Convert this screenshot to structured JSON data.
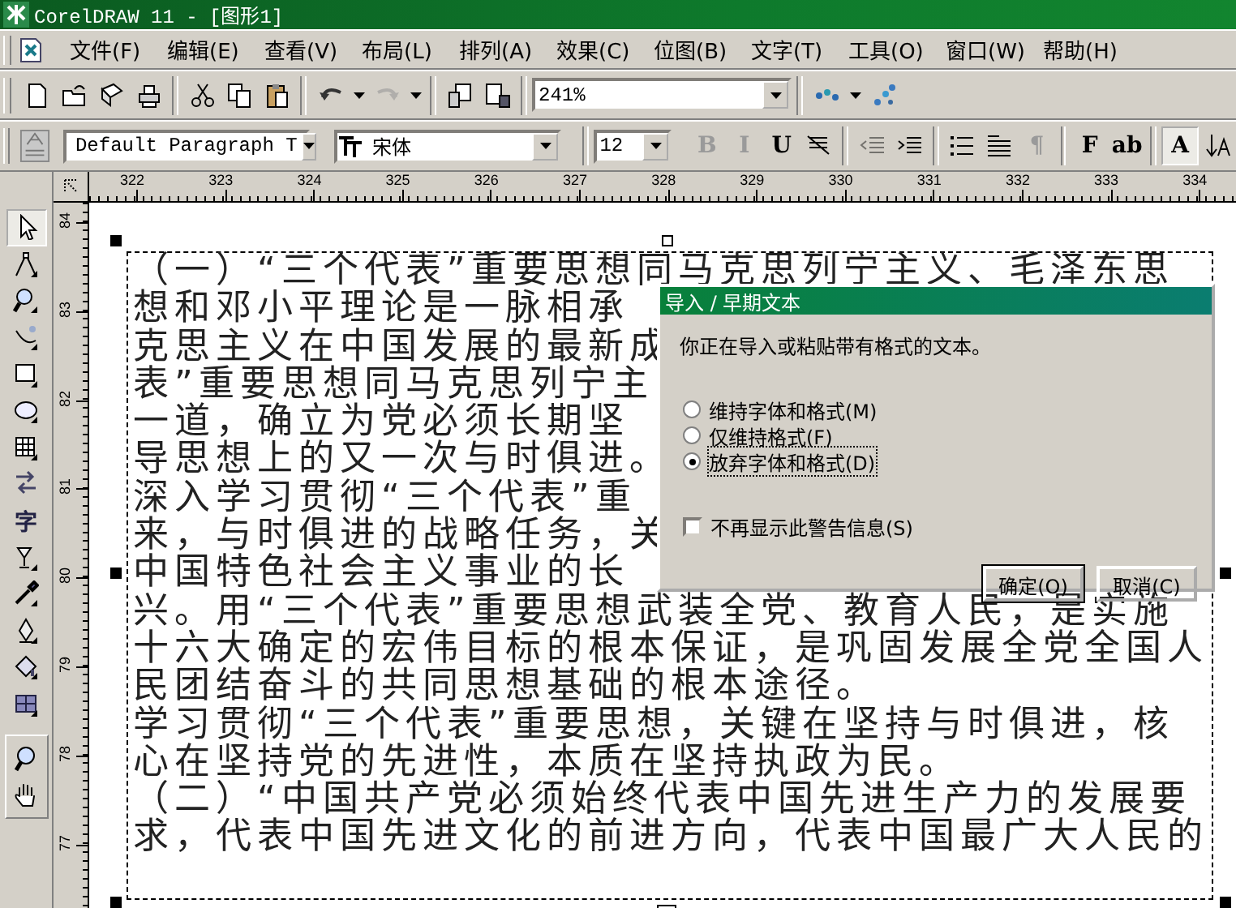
{
  "window": {
    "title": "CorelDRAW 11 - [图形1]"
  },
  "menu": [
    "文件(F)",
    "编辑(E)",
    "查看(V)",
    "布局(L)",
    "排列(A)",
    "效果(C)",
    "位图(B)",
    "文字(T)",
    "工具(O)",
    "窗口(W)",
    "帮助(H)"
  ],
  "standard_toolbar": {
    "redo_disabled": true,
    "zoom": "241%"
  },
  "text_toolbar": {
    "style": "Default Paragraph T",
    "font": "宋体",
    "size": "12",
    "buttons": [
      {
        "kind": "glyph",
        "glyph": "B",
        "disabled": true,
        "pressed": false
      },
      {
        "kind": "glyph",
        "glyph": "I",
        "disabled": true,
        "pressed": false
      },
      {
        "kind": "glyph",
        "glyph": "U",
        "disabled": false,
        "pressed": false
      },
      {
        "kind": "icon",
        "disabled": false,
        "pressed": false
      },
      {
        "kind": "separator"
      },
      {
        "kind": "icon",
        "disabled": true,
        "pressed": false
      },
      {
        "kind": "icon",
        "disabled": false,
        "pressed": false
      },
      {
        "kind": "separator"
      },
      {
        "kind": "icon",
        "disabled": false,
        "pressed": false
      },
      {
        "kind": "icon",
        "disabled": false,
        "pressed": false
      },
      {
        "kind": "glyph",
        "glyph": "¶",
        "disabled": true,
        "pressed": false
      },
      {
        "kind": "separator"
      },
      {
        "kind": "glyph",
        "glyph": "F",
        "disabled": false,
        "pressed": false
      },
      {
        "kind": "glyph",
        "glyph": "ab",
        "disabled": false,
        "pressed": false
      },
      {
        "kind": "separator"
      },
      {
        "kind": "glyph",
        "glyph": "A",
        "disabled": false,
        "pressed": true
      },
      {
        "kind": "icon",
        "disabled": false,
        "pressed": false
      }
    ]
  },
  "toolbox": [
    {
      "kind": "icon",
      "selected": true
    },
    {
      "kind": "icon",
      "selected": false
    },
    {
      "kind": "icon",
      "selected": false
    },
    {
      "kind": "icon",
      "selected": false
    },
    {
      "kind": "icon",
      "selected": false
    },
    {
      "kind": "icon",
      "selected": false
    },
    {
      "kind": "icon",
      "selected": false
    },
    {
      "kind": "icon",
      "selected": false
    },
    {
      "kind": "glyph",
      "glyph": "字",
      "selected": false
    },
    {
      "kind": "icon",
      "selected": false
    },
    {
      "kind": "icon",
      "selected": false
    },
    {
      "kind": "icon",
      "selected": false
    },
    {
      "kind": "icon",
      "selected": false
    },
    {
      "kind": "icon",
      "selected": false
    }
  ],
  "view_tools": [
    {
      "selected": false
    },
    {
      "selected": false
    }
  ],
  "horizontal_ruler": [
    "322",
    "323",
    "324",
    "325",
    "326",
    "327",
    "328",
    "329",
    "330",
    "331",
    "332",
    "333",
    "334"
  ],
  "vertical_ruler": [
    "84",
    "83",
    "82",
    "81",
    "80",
    "79",
    "78",
    "77"
  ],
  "document_lines": [
    "（一）“三个代表”重要思想同马克思列宁主义、毛泽东思",
    "想和邓小平理论是一脉相承",
    "克思主义在中国发展的最新成",
    "表”重要思想同马克思列宁主",
    "一道，确立为党必须长期坚",
    "导思想上的又一次与时俱进。",
    "深入学习贯彻“三个代表”重",
    "来，与时俱进的战略任务，关",
    "中国特色社会主义事业的长",
    "兴。用“三个代表”重要思想武装全党、教育人民，是实施",
    "十六大确定的宏伟目标的根本保证，是巩固发展全党全国人",
    "民团结奋斗的共同思想基础的根本途径。",
    "学习贯彻“三个代表”重要思想，关键在坚持与时俱进，核",
    "心在坚持党的先进性，本质在坚持执政为民。",
    "（二）“中国共产党必须始终代表中国先进生产力的发展要",
    "求，代表中国先进文化的前进方向，代表中国最广大人民的"
  ],
  "dialog": {
    "title": "导入 / 早期文本",
    "message": "你正在导入或粘贴带有格式的文本。",
    "options": [
      {
        "label": "维持字体和格式(M)",
        "selected": false
      },
      {
        "label": "仅维持格式(F)",
        "selected": false
      },
      {
        "label": "放弃字体和格式(D)",
        "selected": true
      }
    ],
    "checkbox": {
      "label": "不再显示此警告信息(S)",
      "checked": false
    },
    "buttons": [
      {
        "label": "确定(O)",
        "default": true
      },
      {
        "label": "取消(C)",
        "default": false
      }
    ]
  }
}
